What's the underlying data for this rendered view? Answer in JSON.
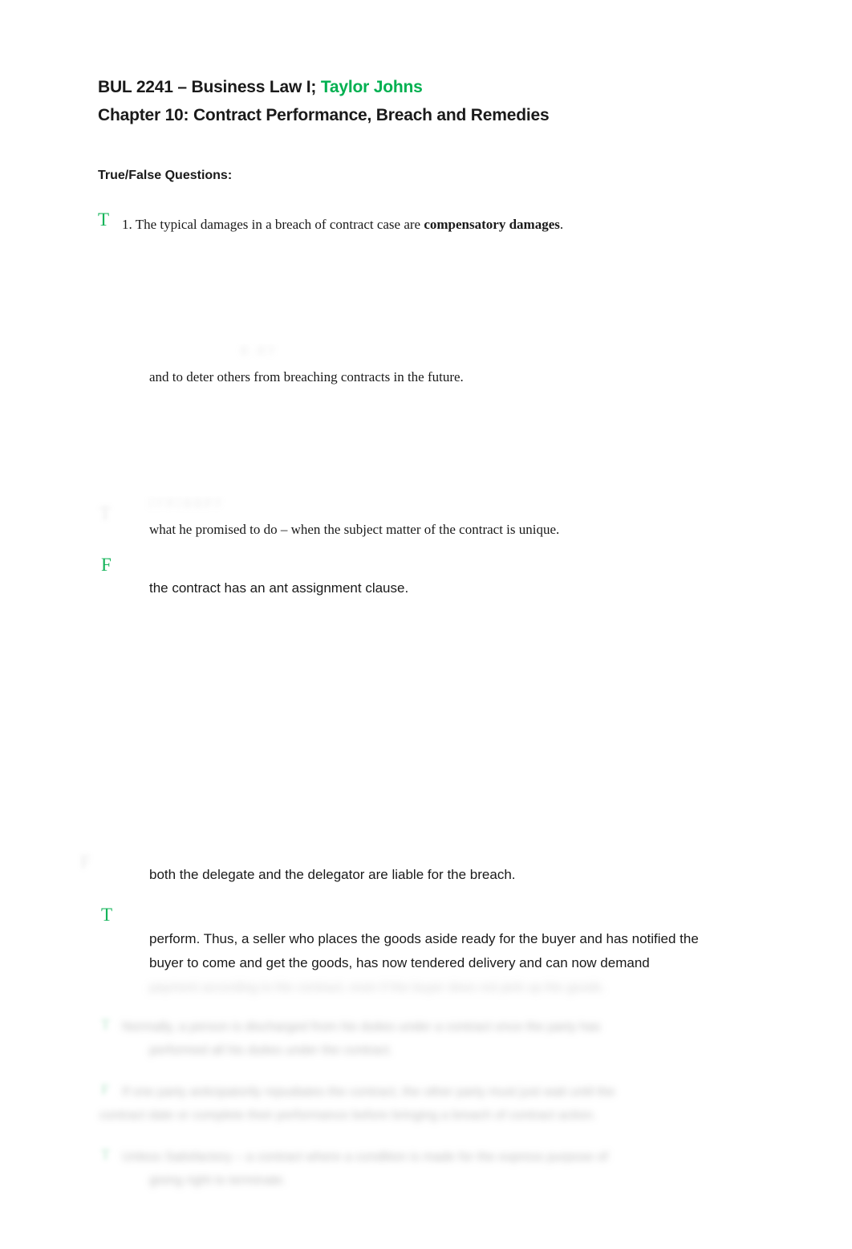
{
  "document": {
    "heading_line_1_prefix": "BUL 2241 – Business Law I; ",
    "heading_line_1_accent": "Taylor Johns",
    "heading_line_2": "Chapter 10:  Contract Performance, Breach and Remedies",
    "section_label": "True/False Questions:",
    "accent_color": "#00b050",
    "marker_color": "#14b45a"
  },
  "questions": [
    {
      "mark": "T",
      "number": "1.",
      "text_before_bold": "The typical damages in a breach of contract case are ",
      "bold_text": "compensatory damages",
      "text_after_bold": "."
    },
    {
      "mark": "",
      "visible_line": "and to deter others from breaching contracts in the future."
    },
    {
      "mark": "",
      "visible_line": "what he promised to do – when the subject matter of the contract is unique."
    },
    {
      "mark": "F",
      "visible_line": "the contract has an ant assignment clause."
    },
    {
      "mark": "",
      "visible_line": "both the delegate and the delegator are liable for the breach."
    },
    {
      "mark": "T",
      "visible_line_1": "perform.  Thus, a seller who places the goods aside ready for the buyer and has notified the",
      "visible_line_2": "buyer to come and get the goods, has now tendered delivery and can now demand",
      "obscured_line_3": "payment according to the contract, even if the buyer does not pick up the goods."
    }
  ],
  "obscured_questions": [
    {
      "mark": "T",
      "line_1": "Normally, a person is discharged from his duties under a contract once the party has",
      "line_2": "performed all his duties under the contract."
    },
    {
      "mark": "F",
      "line_1": "If one party anticipatorily repudiates the contract, the other party must just wait until the",
      "line_2": "contract date or complete their performance before bringing a breach of contract action."
    },
    {
      "mark": "T",
      "line_1": "Unless Satisfactory – a contract where a condition is made for the express purpose of",
      "line_2": "giving right to terminate."
    }
  ]
}
